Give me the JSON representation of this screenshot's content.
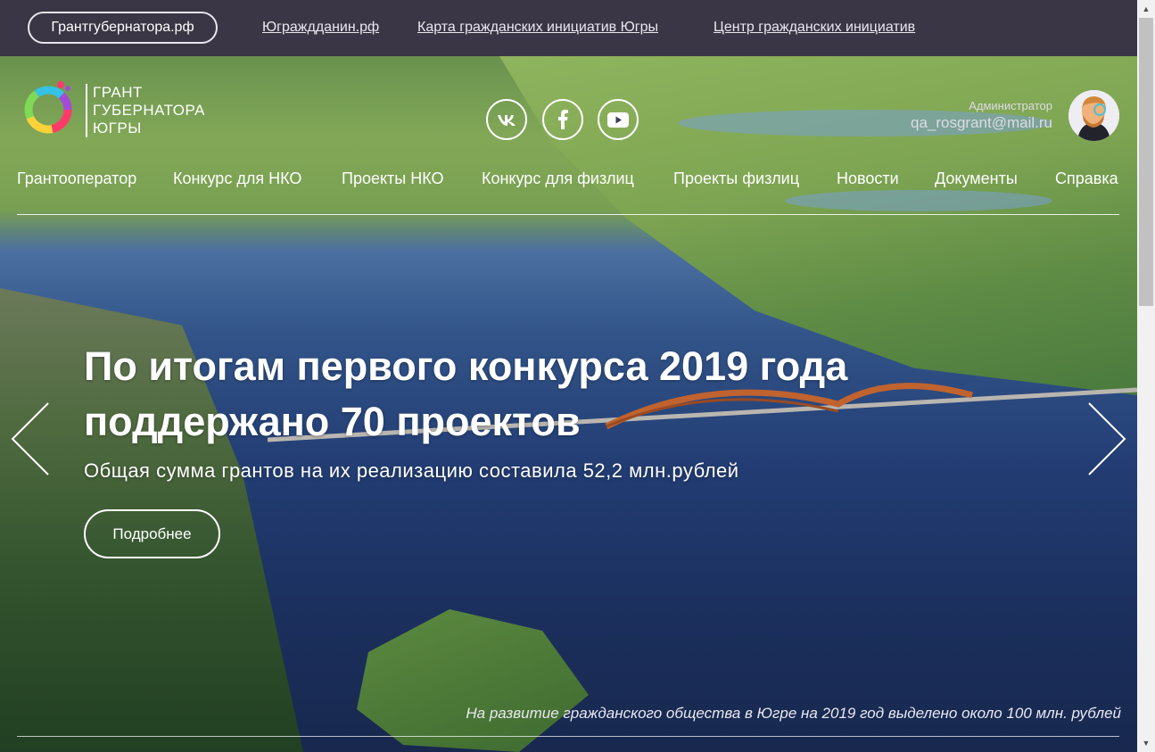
{
  "topbar": {
    "primary_link": "Грантгубернатора.рф",
    "links": [
      "Юграждданин.рф",
      "Карта гражданских инициатив Югры",
      "Центр гражданских инициатив"
    ]
  },
  "logo": {
    "lines": [
      "ГРАНТ",
      "ГУБЕРНАТОРА",
      "ЮГРЫ"
    ]
  },
  "socials": [
    "vk-icon",
    "facebook-icon",
    "youtube-icon"
  ],
  "user": {
    "role": "Администратор",
    "email": "qa_rosgrant@mail.ru"
  },
  "nav": {
    "items": [
      "Грантооператор",
      "Конкурс для НКО",
      "Проекты НКО",
      "Конкурс для физлиц",
      "Проекты физлиц",
      "Новости",
      "Документы",
      "Справка"
    ]
  },
  "slide": {
    "title_line1": "По итогам первого конкурса 2019 года",
    "title_line2": "поддержано 70 проектов",
    "subtitle": "Общая сумма грантов на их реализацию составила 52,2 млн.рублей",
    "button": "Подробнее"
  },
  "caption": "На развитие гражданского общества в Югре на 2019 год выделено около 100 млн. рублей"
}
